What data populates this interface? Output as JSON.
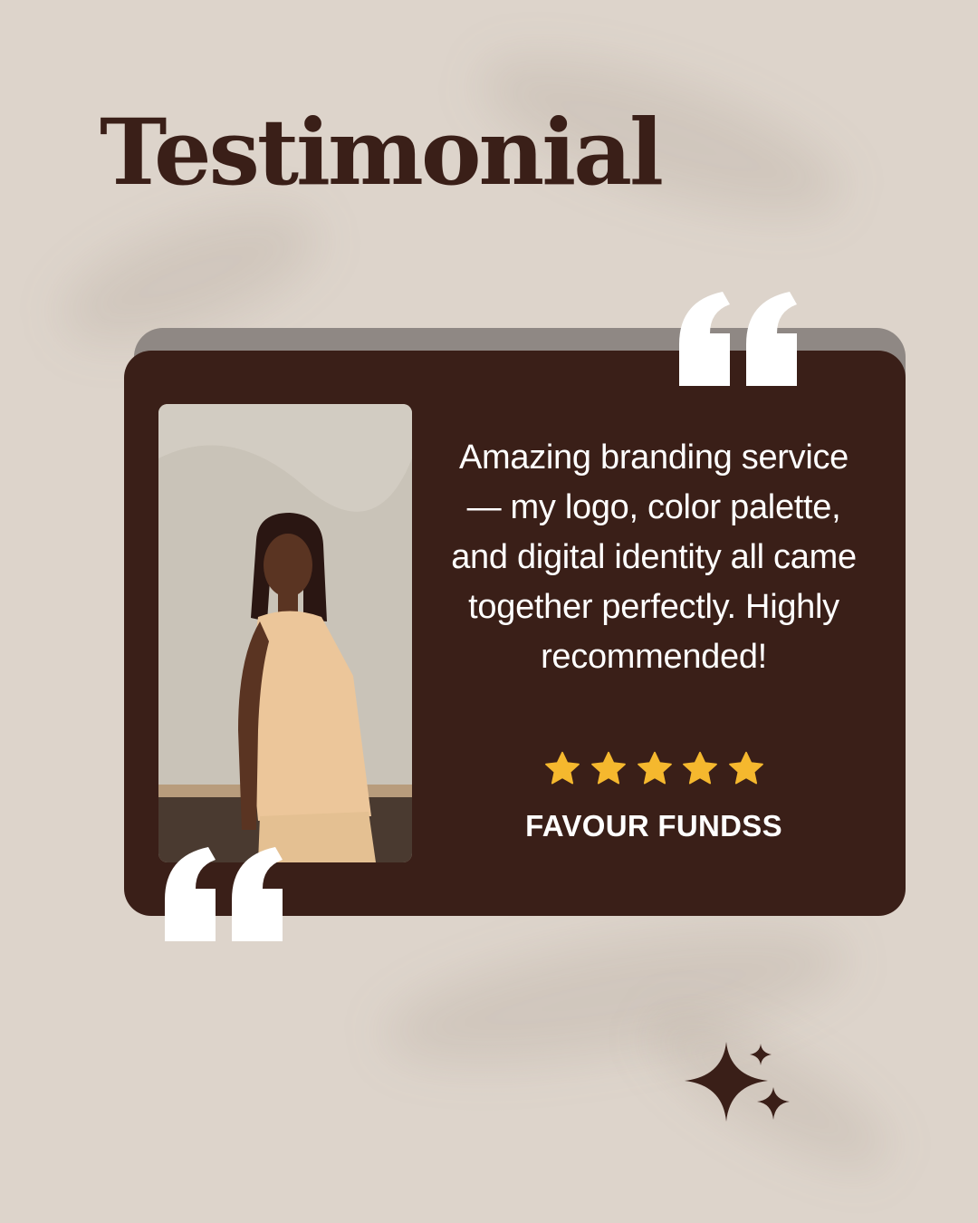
{
  "page": {
    "title": "Testimonial"
  },
  "testimonial": {
    "quote": "Amazing branding service — my logo, color palette, and digital identity all came together perfectly. Highly recommended!",
    "rating": 5,
    "rating_max": 5,
    "author": "FAVOUR FUNDSS"
  },
  "icons": {
    "open_quote_top": "quote-icon",
    "open_quote_bottom": "quote-icon",
    "star": "star-icon",
    "sparkle": "sparkle-icon"
  },
  "colors": {
    "background": "#ddd4cb",
    "card": "#3a1f18",
    "title": "#3a1f18",
    "star": "#f5b82e",
    "text": "#ffffff"
  }
}
